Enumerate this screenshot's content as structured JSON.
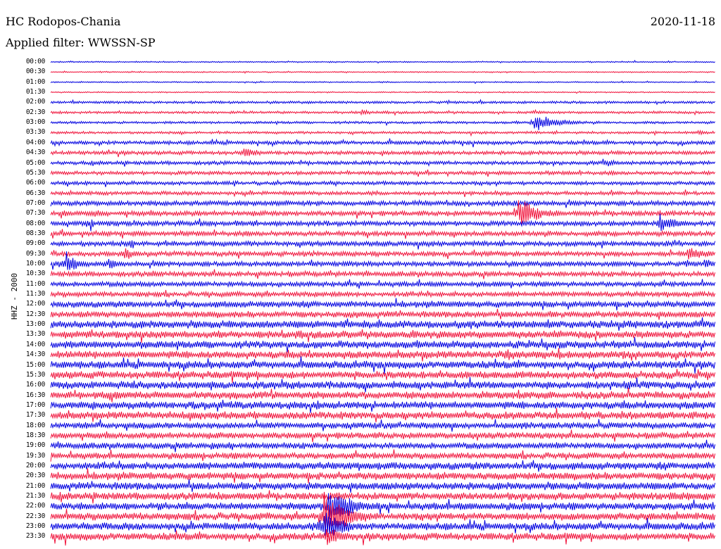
{
  "header": {
    "station": "HC Rodopos-Chania",
    "filter": "Applied filter: WWSSN-SP",
    "date": "2020-11-18",
    "channel": "HHZ - 2000"
  },
  "colors": {
    "odd_rows": "#0000e0",
    "even_rows": "#f0143c",
    "background": "#ffffff"
  },
  "helicorder": {
    "row_labels": [
      "00:00",
      "00:30",
      "01:00",
      "01:30",
      "02:00",
      "02:30",
      "03:00",
      "03:30",
      "04:00",
      "04:30",
      "05:00",
      "05:30",
      "06:00",
      "06:30",
      "07:00",
      "07:30",
      "08:00",
      "08:30",
      "09:00",
      "09:30",
      "10:00",
      "10:30",
      "11:00",
      "11:30",
      "12:00",
      "12:30",
      "13:00",
      "13:30",
      "14:00",
      "14:30",
      "15:00",
      "15:30",
      "16:00",
      "16:30",
      "17:00",
      "17:30",
      "18:00",
      "18:30",
      "19:00",
      "19:30",
      "20:00",
      "20:30",
      "21:00",
      "21:30",
      "22:00",
      "22:30",
      "23:00",
      "23:30"
    ],
    "row_minutes": 30,
    "noise_level": [
      1,
      1,
      1,
      1,
      2,
      2,
      2,
      2,
      3,
      3,
      3,
      3,
      3,
      3,
      4,
      4,
      4,
      4,
      4,
      4,
      4,
      4,
      4,
      4,
      5,
      5,
      6,
      6,
      6,
      6,
      6,
      6,
      6,
      6,
      6,
      6,
      5,
      5,
      5,
      5,
      6,
      6,
      6,
      6,
      6,
      6,
      6,
      6
    ],
    "events": [
      {
        "row": 5,
        "minute": 14,
        "amplitude": 6,
        "duration_min": 1
      },
      {
        "row": 6,
        "minute": 21.8,
        "amplitude": 14,
        "duration_min": 2.5
      },
      {
        "row": 7,
        "minute": 29.2,
        "amplitude": 4,
        "duration_min": 1
      },
      {
        "row": 9,
        "minute": 8.7,
        "amplitude": 10,
        "duration_min": 1.5
      },
      {
        "row": 10,
        "minute": 24.9,
        "amplitude": 8,
        "duration_min": 1.5
      },
      {
        "row": 15,
        "minute": 0.5,
        "amplitude": 6,
        "duration_min": 2
      },
      {
        "row": 15,
        "minute": 2,
        "amplitude": 8,
        "duration_min": 1
      },
      {
        "row": 15,
        "minute": 21.1,
        "amplitude": 26,
        "duration_min": 2
      },
      {
        "row": 16,
        "minute": 1.8,
        "amplitude": 20,
        "duration_min": 0.3
      },
      {
        "row": 16,
        "minute": 27.5,
        "amplitude": 18,
        "duration_min": 1.5
      },
      {
        "row": 17,
        "minute": 18,
        "amplitude": 6,
        "duration_min": 1
      },
      {
        "row": 18,
        "minute": 3.6,
        "amplitude": 14,
        "duration_min": 0.4
      },
      {
        "row": 19,
        "minute": 3.3,
        "amplitude": 14,
        "duration_min": 1
      },
      {
        "row": 19,
        "minute": 28.7,
        "amplitude": 12,
        "duration_min": 2.5
      },
      {
        "row": 20,
        "minute": 0.7,
        "amplitude": 22,
        "duration_min": 1
      },
      {
        "row": 20,
        "minute": 2.6,
        "amplitude": 12,
        "duration_min": 1
      },
      {
        "row": 20,
        "minute": 29.5,
        "amplitude": 10,
        "duration_min": 1
      },
      {
        "row": 21,
        "minute": 4.6,
        "amplitude": 10,
        "duration_min": 0.5
      },
      {
        "row": 26,
        "minute": 12.5,
        "amplitude": 6,
        "duration_min": 2
      },
      {
        "row": 27,
        "minute": 16.2,
        "amplitude": 10,
        "duration_min": 1.5
      },
      {
        "row": 29,
        "minute": 20.5,
        "amplitude": 10,
        "duration_min": 2
      },
      {
        "row": 34,
        "minute": 12,
        "amplitude": 12,
        "duration_min": 0.5
      },
      {
        "row": 44,
        "minute": 12.5,
        "amplitude": 34,
        "duration_min": 2.5
      },
      {
        "row": 45,
        "minute": 12.3,
        "amplitude": 40,
        "duration_min": 2.5
      },
      {
        "row": 46,
        "minute": 12.3,
        "amplitude": 30,
        "duration_min": 2
      },
      {
        "row": 47,
        "minute": 12.4,
        "amplitude": 20,
        "duration_min": 1.5
      }
    ]
  }
}
